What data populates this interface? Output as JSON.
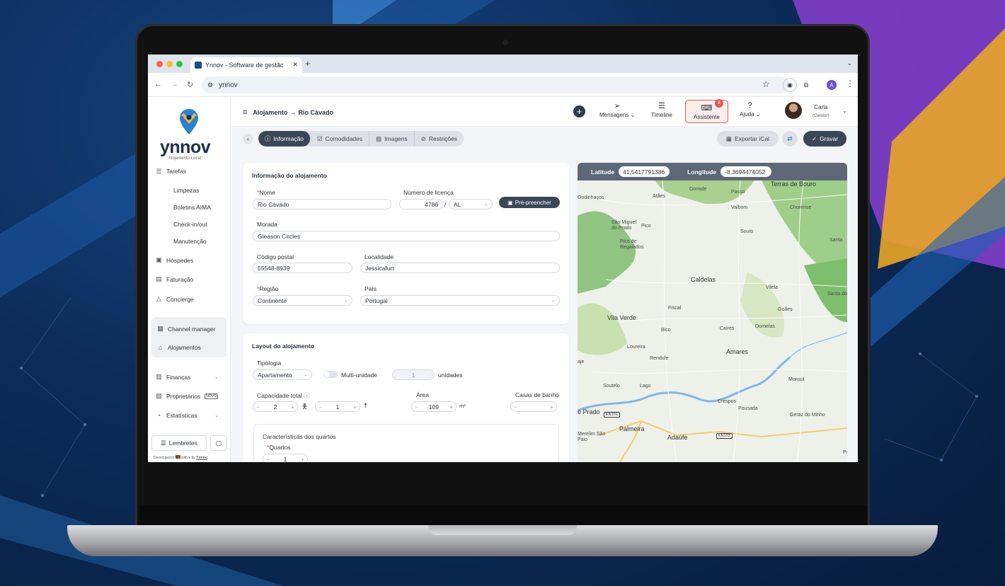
{
  "browser": {
    "tab_title": "Ynnov - Software de gestão de Alojamento Local",
    "url": "ynnov",
    "profile_initial": "A"
  },
  "brand": {
    "name": "ynnov",
    "subtitle": "Alojamento Local",
    "accent": "#3b4659"
  },
  "sidebar": {
    "tarefas": "Tarefas",
    "subitems": [
      "Limpezas",
      "Boletins AIMA",
      "Check-in/out",
      "Manutenção"
    ],
    "items": [
      {
        "label": "Hóspedes",
        "icon": "guests-icon"
      },
      {
        "label": "Faturação",
        "icon": "invoice-icon"
      },
      {
        "label": "Concierge",
        "icon": "concierge-icon"
      },
      {
        "label": "Channel manager",
        "icon": "calendar-icon"
      },
      {
        "label": "Alojamentos",
        "icon": "home-icon"
      },
      {
        "label": "Finanças",
        "icon": "chart-icon"
      },
      {
        "label": "Proprietários",
        "icon": "owners-icon",
        "badge": "NOVO"
      },
      {
        "label": "Estatísticas",
        "icon": "stats-icon"
      }
    ],
    "lembretes": "Lembretes",
    "developed": "Developed in",
    "with": "with",
    "by": "by",
    "by_name": "Ynnov"
  },
  "header": {
    "crumb_parent": "Alojamento",
    "crumb_arrow": "→",
    "crumb_current": "Rio Cávado",
    "mensagens": "Mensagens",
    "timeline": "Timeline",
    "assistente": "Assistente",
    "assistente_badge": "8",
    "ajuda": "Ajuda",
    "user_name": "Carla",
    "user_role": "(Gestor)"
  },
  "tabs": [
    "Informação",
    "Comodidades",
    "Imagens",
    "Restrições"
  ],
  "actions": {
    "exportar": "Exportar iCal",
    "gravar": "Gravar"
  },
  "info": {
    "title": "Informação do alojamento",
    "nome_label": "Nome",
    "nome": "Rio Cávado",
    "licenca_label": "Número de licença",
    "licenca": "4786",
    "licenca_sep": "/",
    "licenca_tipo": "AL",
    "prefill": "Pré-preencher",
    "morada_label": "Morada",
    "morada": "Gleason Circles",
    "cp_label": "Código postal",
    "cp": "55548-8939",
    "localidade_label": "Localidade",
    "localidade": "Jessicafurt",
    "regiao_label": "Região",
    "regiao": "Continente",
    "pais_label": "País",
    "pais": "Portugal"
  },
  "layout": {
    "title": "Layout do alojamento",
    "tipologia_label": "Tipologia",
    "tipologia": "Apartamento",
    "multi_label": "Multi-unidade",
    "unidades": "1",
    "unidades_label": "unidades",
    "capacidade_label": "Capacidade total",
    "adultos": "2",
    "criancas": "1",
    "area_label": "Área",
    "area": "109",
    "area_unit": "m²",
    "casas_label": "Casas de banho",
    "casas": "",
    "quartos_title": "Características dos quartos",
    "quartos_label": "Quartos",
    "quartos": "1"
  },
  "map": {
    "lat_label": "Latitude",
    "lat": "41,5417791386",
    "lon_label": "Longitude",
    "lon": "-8,3694474052",
    "places": [
      "Terras de Bouro",
      "Gomide",
      "Passo",
      "Atães",
      "Godinhaços",
      "Valbom",
      "Chorense",
      "São Miguel do Prado",
      "Pico",
      "Souto",
      "Santa",
      "Pico de Regalados",
      "Caldelas",
      "Vilela",
      "Santa do B",
      "Fiscal",
      "Goães",
      "Vila Verde",
      "Bico",
      "Caires",
      "Dornelas",
      "Loureira",
      "Amares",
      "Rendufe",
      "aje",
      "Soutelo",
      "Lago",
      "Monsul",
      "Crespos",
      "Pousada",
      "e Prado",
      "Palmeira",
      "Geraz do Minho",
      "Merelim São Paio",
      "Adaúfe",
      "Póvo Lan"
    ],
    "roads": [
      "EN101",
      "EN103"
    ]
  }
}
